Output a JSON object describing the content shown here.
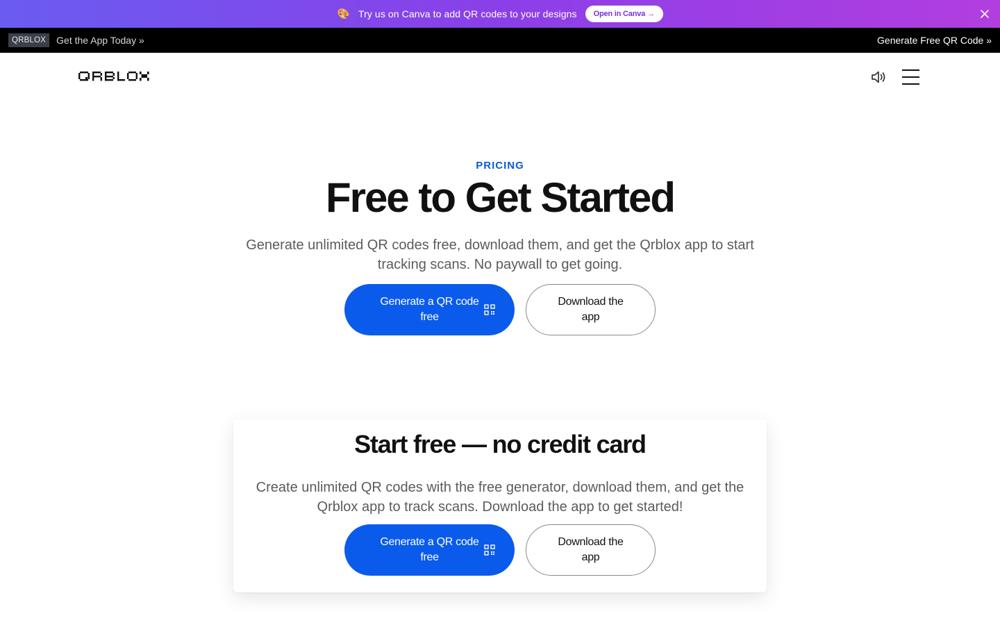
{
  "promo": {
    "icon": "palette-icon",
    "text": "Try us on Canva to add QR codes to your designs",
    "button_label": "Open in Canva →",
    "gradient": [
      "#6a5cf0",
      "#b23ee0"
    ]
  },
  "app_bar": {
    "brand_chip": "QRBLOX",
    "get_app_link": "Get the App Today »",
    "generate_link": "Generate Free QR Code »"
  },
  "nav": {
    "logo_text": "QRBLOX"
  },
  "hero": {
    "eyebrow": "PRICING",
    "title": "Free to Get Started",
    "subtitle": "Generate unlimited QR codes free, download them, and get the Qrblox app to start tracking scans. No paywall to get going.",
    "primary_cta": "Generate a QR code free",
    "secondary_cta": "Download the app"
  },
  "card": {
    "title": "Start free — no credit card",
    "subtitle": "Create unlimited QR codes with the free generator, download them, and get the Qrblox app to track scans. Download the app to get started!",
    "primary_cta": "Generate a QR code free",
    "secondary_cta": "Download the app"
  },
  "colors": {
    "accent": "#0a5bec",
    "eyebrow": "#0a5bd8",
    "text": "#111111",
    "muted": "#5b5b5b"
  }
}
